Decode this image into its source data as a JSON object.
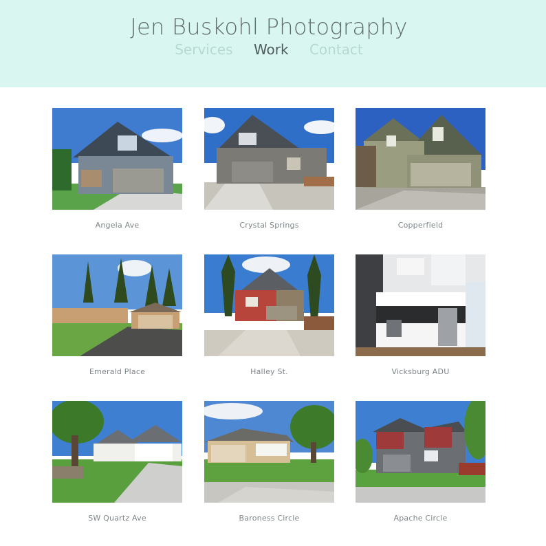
{
  "header": {
    "title": "Jen Buskohl Photography",
    "nav": [
      {
        "label": "Services",
        "active": false
      },
      {
        "label": "Work",
        "active": true
      },
      {
        "label": "Contact",
        "active": false
      }
    ]
  },
  "gallery": [
    {
      "caption": "Angela Ave",
      "scene": "gray two-story house with stone accents"
    },
    {
      "caption": "Crystal Springs",
      "scene": "gray craftsman house with two-car garage"
    },
    {
      "caption": "Copperfield",
      "scene": "olive-green two-story house"
    },
    {
      "caption": "Emerald Place",
      "scene": "single-story ranch house among pine trees"
    },
    {
      "caption": "Halley St.",
      "scene": "red and tan house with pine trees"
    },
    {
      "caption": "Vicksburg ADU",
      "scene": "modern kitchen interior"
    },
    {
      "caption": "SW Quartz Ave",
      "scene": "white ranch house with shade tree"
    },
    {
      "caption": "Baroness Circle",
      "scene": "tan single-story house with lawn"
    },
    {
      "caption": "Apache Circle",
      "scene": "two-story house with red accents"
    }
  ],
  "colors": {
    "header_bg": "#d9f7f0",
    "nav_inactive": "#b6d9cf",
    "nav_active": "#4f5a5e"
  }
}
